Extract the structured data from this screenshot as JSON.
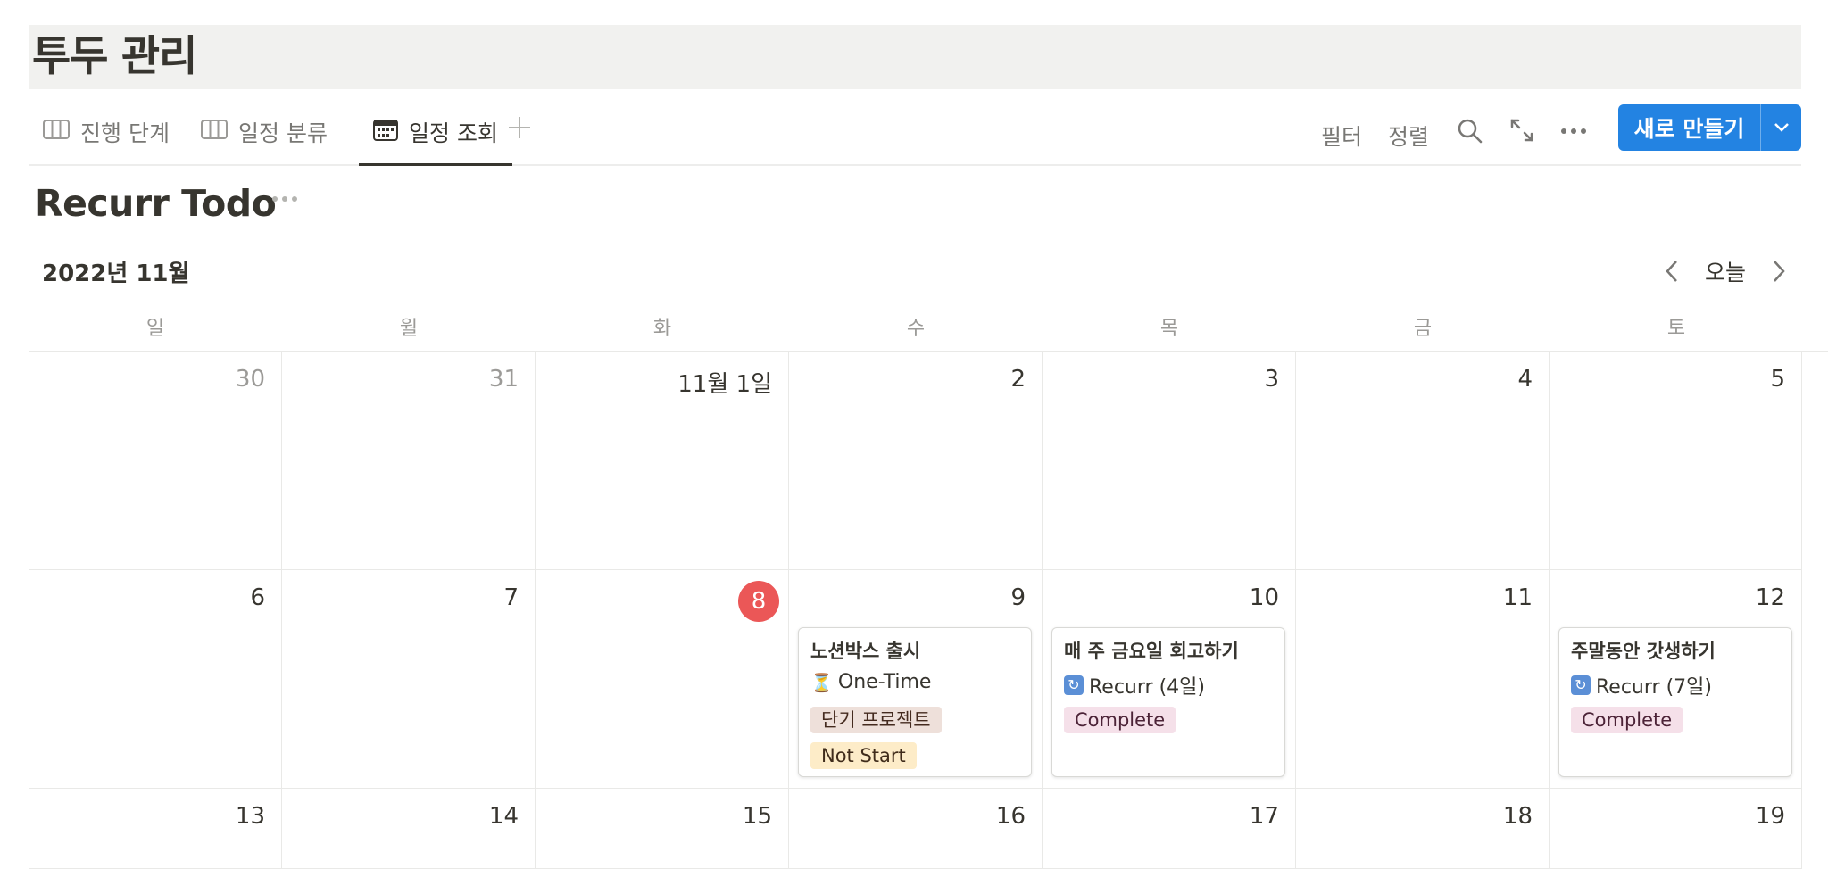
{
  "page": {
    "title": "투두 관리"
  },
  "tabs": [
    {
      "label": "진행 단계",
      "icon": "board-icon"
    },
    {
      "label": "일정 분류",
      "icon": "board-icon"
    },
    {
      "label": "일정 조회",
      "icon": "calendar-icon",
      "active": true
    }
  ],
  "toolbar": {
    "filter_label": "필터",
    "sort_label": "정렬",
    "new_label": "새로 만들기",
    "accent_color": "#2383e2"
  },
  "view": {
    "title": "Recurr Todo"
  },
  "calendar": {
    "month_label": "2022년 11월",
    "today_label": "오늘",
    "weekdays": [
      "일",
      "월",
      "화",
      "수",
      "목",
      "금",
      "토"
    ],
    "weeks": [
      [
        {
          "label": "30",
          "muted": true
        },
        {
          "label": "31",
          "muted": true
        },
        {
          "label": "11월 1일"
        },
        {
          "label": "2"
        },
        {
          "label": "3"
        },
        {
          "label": "4"
        },
        {
          "label": "5"
        }
      ],
      [
        {
          "label": "6"
        },
        {
          "label": "7"
        },
        {
          "label": "8",
          "today": true
        },
        {
          "label": "9"
        },
        {
          "label": "10"
        },
        {
          "label": "11"
        },
        {
          "label": "12"
        }
      ],
      [
        {
          "label": "13"
        },
        {
          "label": "14"
        },
        {
          "label": "15"
        },
        {
          "label": "16"
        },
        {
          "label": "17"
        },
        {
          "label": "18"
        },
        {
          "label": "19"
        }
      ]
    ],
    "events": [
      {
        "week": 1,
        "day": 3,
        "title": "노션박스 출시",
        "type_icon": "⏳",
        "type_label": "One-Time",
        "tags": [
          {
            "label": "단기 프로젝트",
            "color": "brown"
          },
          {
            "label": "Not Start",
            "color": "yellow"
          }
        ]
      },
      {
        "week": 1,
        "day": 4,
        "title": "매 주 금요일 회고하기",
        "type_icon": "🔄",
        "type_label": "Recurr (4일)",
        "tags": [
          {
            "label": "Complete",
            "color": "pink"
          }
        ]
      },
      {
        "week": 1,
        "day": 6,
        "title": "주말동안 갓생하기",
        "type_icon": "🔄",
        "type_label": "Recurr (7일)",
        "tags": [
          {
            "label": "Complete",
            "color": "pink"
          }
        ]
      }
    ]
  }
}
